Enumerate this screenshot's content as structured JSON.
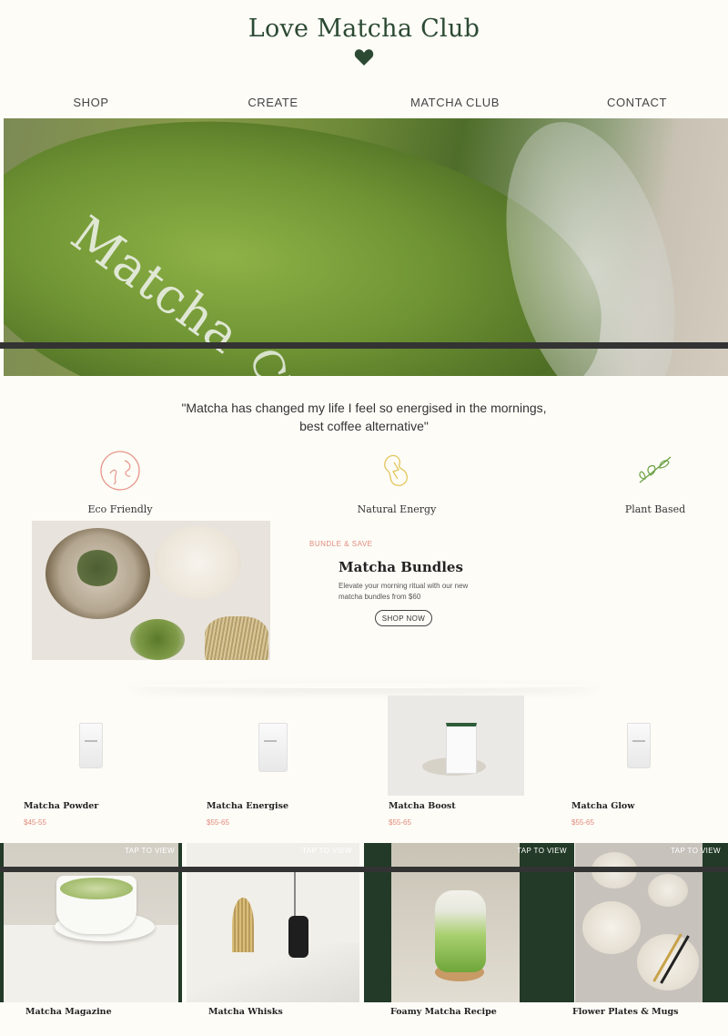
{
  "brand": {
    "name": "Love Matcha Club",
    "color": "#2c4a33"
  },
  "nav": [
    "SHOP",
    "CREATE",
    "MATCHA CLUB",
    "CONTACT"
  ],
  "hero": {
    "cup_text_1": "Matcha",
    "cup_text_2": "Club"
  },
  "quote": {
    "line1": "\"Matcha has changed my life I feel so energised in the mornings,",
    "line2": "best coffee alternative\""
  },
  "features": [
    {
      "label": "Eco Friendly",
      "icon": "globe-leaf-icon"
    },
    {
      "label": "Natural Energy",
      "icon": "energy-hand-icon"
    },
    {
      "label": "Plant Based",
      "icon": "plant-icon"
    }
  ],
  "bundle": {
    "tag": "BUNDLE & SAVE",
    "title": "Matcha Bundles",
    "text": "Elevate your morning ritual with our new matcha bundles from $60",
    "button": "SHOP NOW"
  },
  "products": [
    {
      "name": "Matcha Powder",
      "price": "$45-55"
    },
    {
      "name": "Matcha Energise",
      "price": "$55-65"
    },
    {
      "name": "Matcha Boost",
      "price": "$55-65"
    },
    {
      "name": "Matcha Glow",
      "price": "$55-65"
    }
  ],
  "gallery": [
    {
      "name": "Matcha Magazine",
      "tap": "TAP TO VIEW"
    },
    {
      "name": "Matcha Whisks",
      "tap": "TAP TO VIEW"
    },
    {
      "name": "Foamy Matcha Recipe",
      "tap": "TAP TO VIEW"
    },
    {
      "name": "Flower Plates & Mugs",
      "tap": "TAP TO VIEW"
    }
  ],
  "colors": {
    "accent": "#e28b7c",
    "dark_green": "#223a27"
  }
}
